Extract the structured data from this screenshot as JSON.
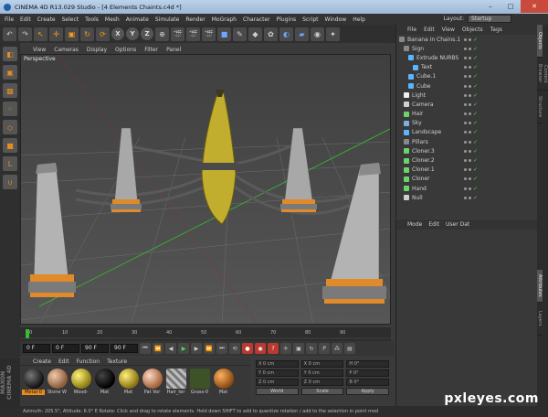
{
  "window": {
    "title": "CINEMA 4D R13.029 Studio - [4 Elements Chaints.c4d *]",
    "controls": [
      "–",
      "□",
      "✕"
    ]
  },
  "menubar": {
    "items": [
      "File",
      "Edit",
      "Create",
      "Select",
      "Tools",
      "Mesh",
      "Animate",
      "Simulate",
      "Render",
      "MoGraph",
      "Character",
      "Plugins",
      "Script",
      "Window",
      "Help"
    ],
    "layout_label": "Layout:",
    "layout_value": "Startup"
  },
  "toolbar": {
    "axis_x": "X",
    "axis_y": "Y",
    "axis_z": "Z"
  },
  "viewport": {
    "menu": [
      "View",
      "Cameras",
      "Display",
      "Options",
      "Filter",
      "Panel"
    ],
    "label": "Perspective",
    "colors": {
      "grid": "#7a7a7a",
      "axis_green": "#32c832",
      "axis_red": "#c83232",
      "chain": "#575757",
      "pillar": "#b3b3b3",
      "pillar_band": "#e08a2a",
      "banana": "#c9b530"
    }
  },
  "timeline": {
    "ticks": [
      "0",
      "10",
      "20",
      "30",
      "40",
      "50",
      "60",
      "70",
      "80",
      "90"
    ]
  },
  "transport": {
    "start_frame": "0 F",
    "current_frame": "0 F",
    "end_frame": "90 F",
    "end_frame_2": "90 F"
  },
  "materials": {
    "menu": [
      "Create",
      "Edit",
      "Function",
      "Texture"
    ],
    "items": [
      {
        "label": "Metal-0",
        "color": "#1a1a1a",
        "selected": true
      },
      {
        "label": "Stone W",
        "color": "#c08f6a",
        "selected": false
      },
      {
        "label": "Wood-",
        "color": "#d8c83a",
        "selected": false
      },
      {
        "label": "Mat",
        "color": "#050505",
        "selected": false
      },
      {
        "label": "Mat",
        "color": "#e0c020",
        "selected": false
      },
      {
        "label": "Pat Vor",
        "color": "#e7a37c",
        "selected": false
      },
      {
        "label": "Hair_ter",
        "color": "#9a9a9a",
        "selected": false
      },
      {
        "label": "Grass-0",
        "color": "#3d5226",
        "selected": false
      },
      {
        "label": "Mat",
        "color": "#e07a1a",
        "selected": false
      }
    ]
  },
  "coords": {
    "rows": [
      [
        "X 0 cm",
        "X 0 cm",
        "H 0°"
      ],
      [
        "Y 0 cm",
        "Y 0 cm",
        "P 0°"
      ],
      [
        "Z 0 cm",
        "Z 0 cm",
        "B 0°"
      ]
    ],
    "world": "World",
    "scale": "Scale",
    "apply": "Apply"
  },
  "maxon": "MAXON CINEMA 4D",
  "objects": {
    "menu": [
      "File",
      "Edit",
      "View",
      "Objects",
      "Tags"
    ],
    "items": [
      {
        "name": "Banana in Chains.1",
        "color": "#888888",
        "indent": 0
      },
      {
        "name": "Sign",
        "color": "#888888",
        "indent": 1
      },
      {
        "name": "Extrude NURBS",
        "color": "#5ab4ff",
        "indent": 2
      },
      {
        "name": "Text",
        "color": "#5ab4ff",
        "indent": 3
      },
      {
        "name": "Cube.1",
        "color": "#5ab4ff",
        "indent": 2
      },
      {
        "name": "Cube",
        "color": "#5ab4ff",
        "indent": 2
      },
      {
        "name": "Light",
        "color": "#f0f0f0",
        "indent": 1
      },
      {
        "name": "Camera",
        "color": "#cfcfcf",
        "indent": 1
      },
      {
        "name": "Hair",
        "color": "#6ad46a",
        "indent": 1
      },
      {
        "name": "Sky",
        "color": "#7ab0e0",
        "indent": 1
      },
      {
        "name": "Landscape",
        "color": "#5ab4ff",
        "indent": 1
      },
      {
        "name": "Pillars",
        "color": "#888888",
        "indent": 1
      },
      {
        "name": "Cloner.3",
        "color": "#6ad46a",
        "indent": 1
      },
      {
        "name": "Cloner.2",
        "color": "#6ad46a",
        "indent": 1
      },
      {
        "name": "Cloner.1",
        "color": "#6ad46a",
        "indent": 1
      },
      {
        "name": "Cloner",
        "color": "#6ad46a",
        "indent": 1
      },
      {
        "name": "Hand",
        "color": "#6ad46a",
        "indent": 1
      },
      {
        "name": "Null",
        "color": "#cfcfcf",
        "indent": 1
      }
    ]
  },
  "attributes": {
    "menu": [
      "Mode",
      "Edit",
      "User Dat"
    ]
  },
  "sidetabs": [
    "Objects",
    "Content Browser",
    "Structure",
    "Attributes",
    "Layers"
  ],
  "statusbar": "Azimuth: 205.5°, Altitude: 6.0° E   Rotate: Click and drag to rotate elements. Hold down SHIFT to add to quantize rotation / add to the selection in point mod",
  "watermark": "pxleyes.com"
}
